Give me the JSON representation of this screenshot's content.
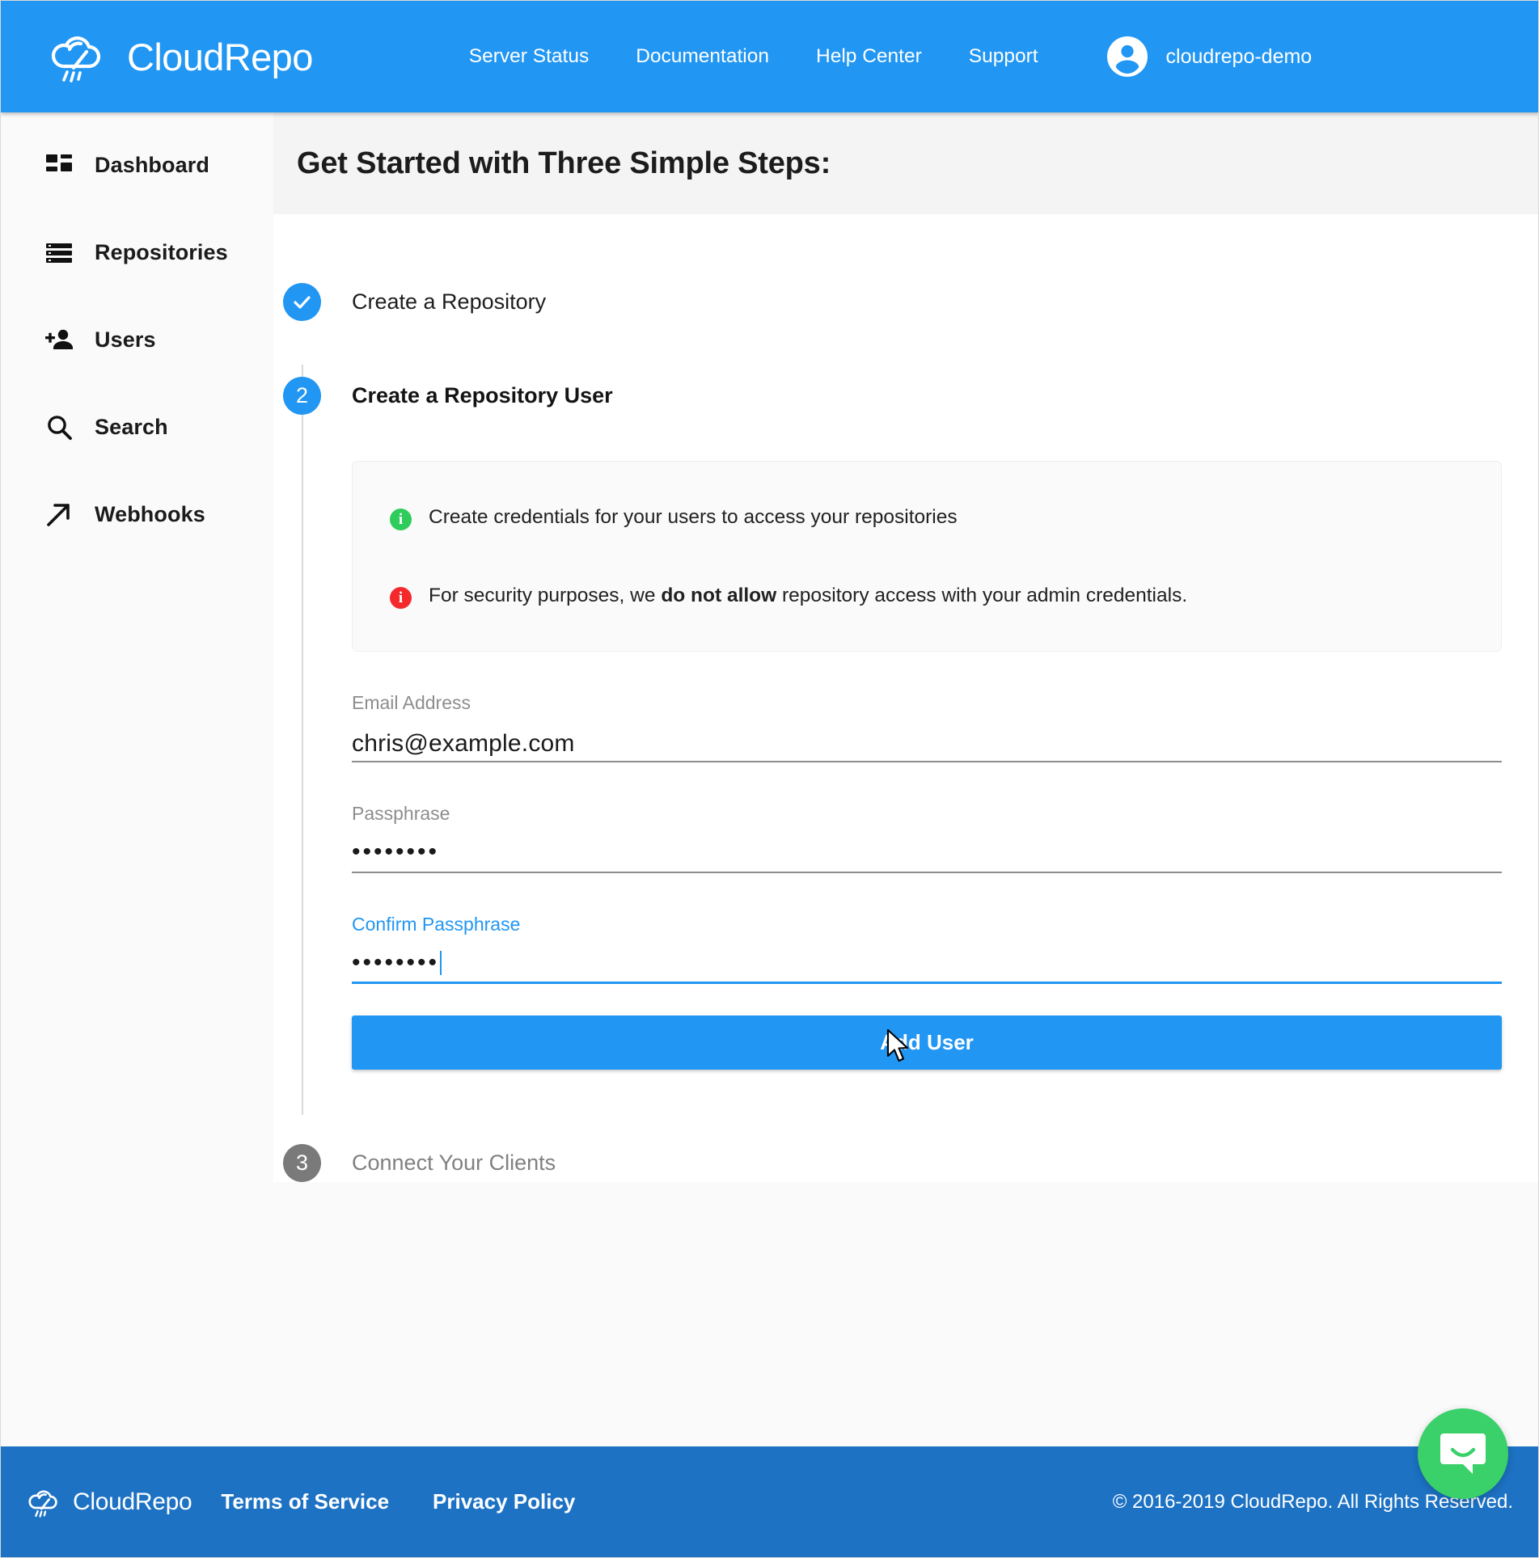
{
  "header": {
    "brand_name": "CloudRepo",
    "brand_logo_icon": "cloud-logo-icon",
    "nav": [
      {
        "label": "Server Status",
        "name": "nav-server-status"
      },
      {
        "label": "Documentation",
        "name": "nav-documentation"
      },
      {
        "label": "Help Center",
        "name": "nav-help-center"
      },
      {
        "label": "Support",
        "name": "nav-support"
      }
    ],
    "account_name": "cloudrepo-demo",
    "avatar_icon": "account-circle-icon",
    "background_color": "#2196f3"
  },
  "sidebar": {
    "items": [
      {
        "label": "Dashboard",
        "icon": "dashboard-icon"
      },
      {
        "label": "Repositories",
        "icon": "storage-icon"
      },
      {
        "label": "Users",
        "icon": "person-add-icon"
      },
      {
        "label": "Search",
        "icon": "search-icon"
      },
      {
        "label": "Webhooks",
        "icon": "arrow-outward-icon"
      }
    ]
  },
  "main": {
    "page_title": "Get Started with Three Simple Steps:",
    "steps": [
      {
        "marker": "check-icon",
        "state": "done",
        "label": "Create a Repository"
      },
      {
        "marker": "2",
        "state": "active",
        "label": "Create a Repository User"
      },
      {
        "marker": "3",
        "state": "todo",
        "label": "Connect Your Clients"
      }
    ],
    "info_panel": {
      "lines": [
        {
          "badge": "i",
          "badge_name": "info-badge-green",
          "badge_color": "#2ecc5a",
          "text_before": "Create credentials for your users to access your repositories",
          "text_bold": "",
          "text_after": ""
        },
        {
          "badge": "i",
          "badge_name": "info-badge-red",
          "badge_color": "#f3292b",
          "text_before": "For security purposes, we ",
          "text_bold": "do not allow",
          "text_after": " repository access with your admin credentials."
        }
      ]
    },
    "form": {
      "email": {
        "label": "Email Address",
        "value": "chris@example.com",
        "focused": false
      },
      "passphrase": {
        "label": "Passphrase",
        "value": "••••••••",
        "focused": false
      },
      "confirm_passphrase": {
        "label": "Confirm Passphrase",
        "value": "••••••••",
        "focused": true
      },
      "submit_label": "Add User"
    }
  },
  "footer": {
    "brand_name": "CloudRepo",
    "brand_logo_icon": "cloud-logo-icon",
    "links": [
      {
        "label": "Terms of Service",
        "name": "footer-link-terms-of-service"
      },
      {
        "label": "Privacy Policy",
        "name": "footer-link-privacy-policy"
      }
    ],
    "copyright": "© 2016-2019 CloudRepo. All Rights Reserved.",
    "background_color": "#1d72c4"
  },
  "chat": {
    "launcher_icon": "chat-bubble-smile-icon",
    "color": "#3ad06a"
  },
  "cursor": {
    "icon": "mouse-pointer-icon"
  }
}
